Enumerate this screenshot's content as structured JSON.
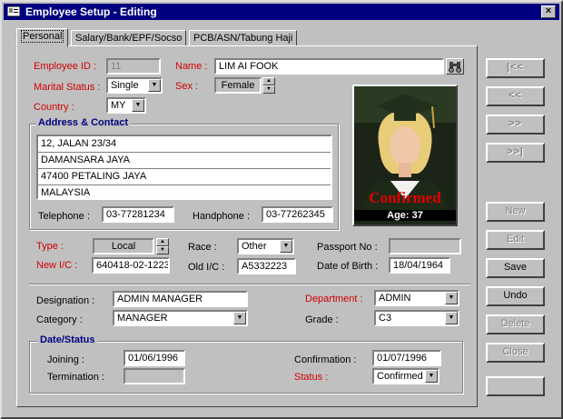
{
  "window": {
    "title": "Employee Setup - Editing",
    "close": "×"
  },
  "tabs": [
    {
      "label": "Personal"
    },
    {
      "label": "Salary/Bank/EPF/Socso"
    },
    {
      "label": "PCB/ASN/Tabung Haji"
    }
  ],
  "personal": {
    "employee_id_label": "Employee ID :",
    "employee_id": "11",
    "name_label": "Name :",
    "name": "LIM AI FOOK",
    "marital_label": "Marital Status :",
    "marital": "Single",
    "sex_label": "Sex :",
    "sex": "Female",
    "country_label": "Country :",
    "country": "MY"
  },
  "address": {
    "title": "Address & Contact",
    "lines": [
      "12, JALAN 23/34",
      "DAMANSARA JAYA",
      "47400 PETALING JAYA",
      "MALAYSIA"
    ],
    "telephone_label": "Telephone :",
    "telephone": "03-77281234",
    "handphone_label": "Handphone :",
    "handphone": "03-77262345"
  },
  "photo": {
    "stamp": "Confirmed",
    "age": "Age: 37"
  },
  "identity": {
    "type_label": "Type :",
    "type": "Local",
    "race_label": "Race :",
    "race": "Other",
    "passport_label": "Passport No :",
    "passport": "",
    "new_ic_label": "New I/C :",
    "new_ic": "640418-02-1223",
    "old_ic_label": "Old I/C :",
    "old_ic": "A5332223",
    "dob_label": "Date of Birth :",
    "dob": "18/04/1964"
  },
  "job": {
    "designation_label": "Designation :",
    "designation": "ADMIN MANAGER",
    "department_label": "Department :",
    "department": "ADMIN",
    "category_label": "Category :",
    "category": "MANAGER",
    "grade_label": "Grade :",
    "grade": "C3"
  },
  "date_status": {
    "title": "Date/Status",
    "joining_label": "Joining :",
    "joining": "01/06/1996",
    "confirmation_label": "Confirmation :",
    "confirmation": "01/07/1996",
    "termination_label": "Termination :",
    "termination": "",
    "status_label": "Status :",
    "status": "Confirmed"
  },
  "buttons": {
    "first": "|<<",
    "prev": "<<",
    "next": ">>",
    "last": ">>|",
    "new": "New",
    "edit": "Edit",
    "save": "Save",
    "undo": "Undo",
    "delete": "Delete",
    "close": "Close",
    "blank": ""
  },
  "colors": {
    "title_bg": "#000080",
    "required_label": "#d00000",
    "group_title": "#000080"
  }
}
